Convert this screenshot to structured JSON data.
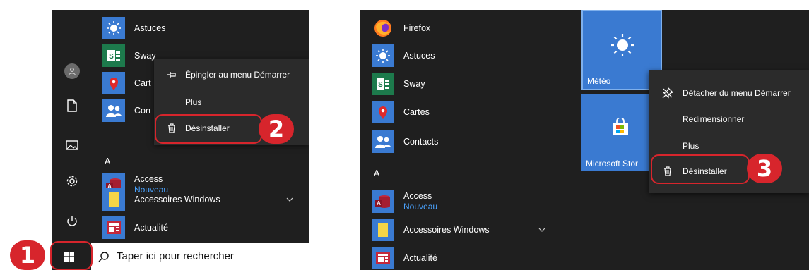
{
  "step_badges": [
    "1",
    "2",
    "3"
  ],
  "left": {
    "rail": [
      "user-avatar",
      "document-icon",
      "pictures-icon",
      "settings-icon",
      "power-icon"
    ],
    "apps_top": [
      {
        "name": "astuces",
        "label": "Astuces"
      },
      {
        "name": "sway",
        "label": "Sway"
      },
      {
        "name": "cartes",
        "label": "Cart"
      },
      {
        "name": "contacts",
        "label": "Con"
      }
    ],
    "section_letter": "A",
    "apps_a": [
      {
        "name": "access",
        "label": "Access",
        "sub": "Nouveau"
      },
      {
        "name": "accessoires-windows",
        "label": "Accessoires Windows"
      },
      {
        "name": "actualite",
        "label": "Actualité"
      }
    ],
    "context_menu": {
      "pin": "Épingler au menu Démarrer",
      "more": "Plus",
      "uninstall": "Désinstaller"
    },
    "search_placeholder": "Taper ici pour rechercher"
  },
  "right": {
    "apps_top": [
      {
        "name": "firefox",
        "label": "Firefox"
      },
      {
        "name": "astuces",
        "label": "Astuces"
      },
      {
        "name": "sway",
        "label": "Sway"
      },
      {
        "name": "cartes",
        "label": "Cartes"
      },
      {
        "name": "contacts",
        "label": "Contacts"
      }
    ],
    "section_letter": "A",
    "apps_a": [
      {
        "name": "access",
        "label": "Access",
        "sub": "Nouveau"
      },
      {
        "name": "accessoires-windows",
        "label": "Accessoires Windows"
      },
      {
        "name": "actualite",
        "label": "Actualité"
      }
    ],
    "tiles": {
      "meteo": "Météo",
      "store": "Microsoft Stor"
    },
    "context_menu": {
      "unpin": "Détacher du menu Démarrer",
      "resize": "Redimensionner",
      "more": "Plus",
      "uninstall": "Désinstaller"
    }
  },
  "colors": {
    "accent_red": "#d7252c",
    "tile_blue": "#3a7ad1",
    "start_bg": "#1f1f1f",
    "menu_bg": "#2b2b2b",
    "link_blue": "#4aa3ff"
  }
}
